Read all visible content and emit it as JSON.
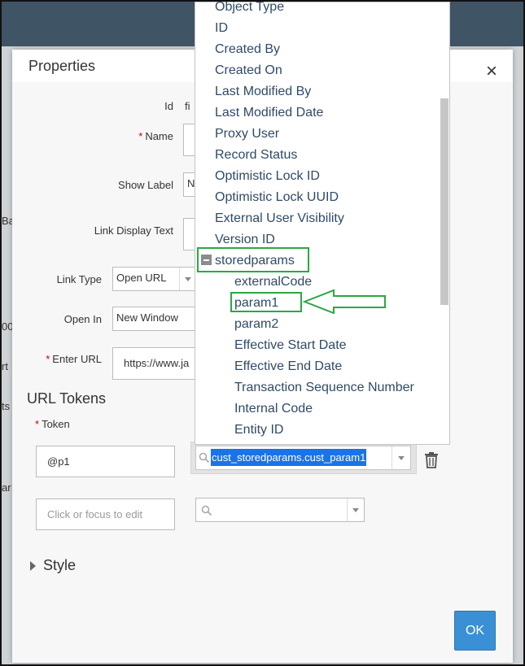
{
  "background": {
    "fragments": [
      "Ba",
      "00",
      "rt",
      "ts",
      "ar"
    ]
  },
  "dialog": {
    "title": "Properties",
    "close_icon": "close-icon",
    "form": {
      "id_label": "Id",
      "id_value": "fi",
      "name_label": "Name",
      "show_label_label": "Show Label",
      "show_label_value": "No",
      "link_display_text_label": "Link Display Text",
      "link_type_label": "Link Type",
      "link_type_value": "Open URL",
      "open_in_label": "Open In",
      "open_in_value": "New Window",
      "enter_url_label": "Enter URL",
      "enter_url_value": "https://www.ja"
    },
    "url_tokens": {
      "heading": "URL Tokens",
      "token_label": "Token",
      "rows": [
        {
          "token": "@p1",
          "field": "cust_storedparams.cust_param1"
        },
        {
          "token_placeholder": "Click or focus to edit",
          "field": ""
        }
      ]
    },
    "style_section": "Style",
    "ok_label": "OK"
  },
  "dropdown": {
    "items": [
      {
        "label": "Object Type",
        "indent": 0
      },
      {
        "label": "ID",
        "indent": 0
      },
      {
        "label": "Created By",
        "indent": 0
      },
      {
        "label": "Created On",
        "indent": 0
      },
      {
        "label": "Last Modified By",
        "indent": 0
      },
      {
        "label": "Last Modified Date",
        "indent": 0
      },
      {
        "label": "Proxy User",
        "indent": 0
      },
      {
        "label": "Record Status",
        "indent": 0
      },
      {
        "label": "Optimistic Lock ID",
        "indent": 0
      },
      {
        "label": "Optimistic Lock UUID",
        "indent": 0
      },
      {
        "label": "External User Visibility",
        "indent": 0
      },
      {
        "label": "Version ID",
        "indent": 0
      },
      {
        "label": "storedparams",
        "indent": 0
      },
      {
        "label": "externalCode",
        "indent": 1
      },
      {
        "label": "param1",
        "indent": 1
      },
      {
        "label": "param2",
        "indent": 1
      },
      {
        "label": "Effective Start Date",
        "indent": 1
      },
      {
        "label": "Effective End Date",
        "indent": 1
      },
      {
        "label": "Transaction Sequence Number",
        "indent": 1
      },
      {
        "label": "Internal Code",
        "indent": 1
      },
      {
        "label": "Entity ID",
        "indent": 1
      }
    ]
  },
  "colors": {
    "highlight": "#2aa846",
    "selection": "#1a73e8",
    "ok_button": "#3a90d4",
    "header_bar": "#3f5465"
  }
}
